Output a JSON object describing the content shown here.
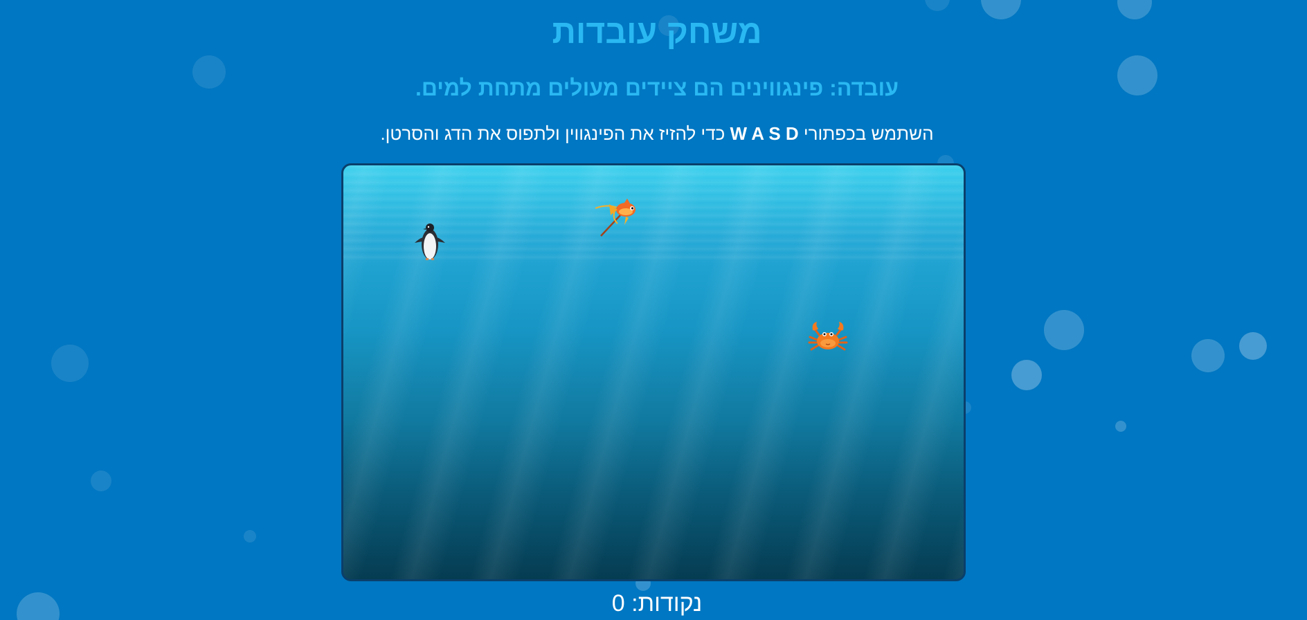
{
  "title": "משחק עובדות",
  "fact": {
    "label": "עובדה:",
    "text": "פינגווינים הם ציידים מעולים מתחת למים."
  },
  "instructions": {
    "prefix": "השתמש בכפתורי",
    "keys": "W A S D",
    "suffix": "כדי להזיז את הפינגווין ולתפוס את הדג והסרטן."
  },
  "score": {
    "label": "נקודות:",
    "value": "0"
  },
  "sprites": {
    "player": "penguin-icon",
    "target_fish": "fish-icon",
    "target_crab": "crab-icon"
  },
  "colors": {
    "background": "#0077c2",
    "heading": "#2ab8f2",
    "text": "#ffffff",
    "game_border": "#0a3f6b"
  }
}
